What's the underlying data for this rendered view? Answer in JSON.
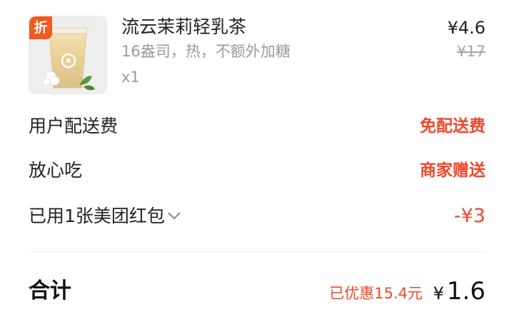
{
  "product": {
    "badge": "折",
    "name": "流云茉莉轻乳茶",
    "spec": "16盎司，热，不额外加糖",
    "quantity": "x1",
    "price": "¥4.6",
    "original_price": "¥17"
  },
  "fees": [
    {
      "label": "用户配送费",
      "value": "免配送费"
    },
    {
      "label": "放心吃",
      "value": "商家赠送"
    },
    {
      "label": "已用1张美团红包",
      "value": "-¥3"
    }
  ],
  "total": {
    "label": "合计",
    "saved": "已优惠15.4元",
    "currency": "¥",
    "amount": "1.6"
  },
  "colors": {
    "accent": "#f0472a",
    "badge": "#f25a1e",
    "muted": "#9a9a9a"
  },
  "icons": {
    "coupon_chevron": "chevron-down-icon"
  }
}
